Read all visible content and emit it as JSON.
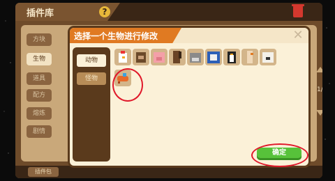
{
  "back_screen": {
    "title": "插件库",
    "help_label": "?",
    "side_tabs": [
      "方块",
      "生物",
      "道具",
      "配方",
      "熔炼",
      "剧情"
    ],
    "active_tab_index": 1,
    "bottom_button": "插件包",
    "page_indicator": "1/"
  },
  "dialog": {
    "title": "选择一个生物进行修改",
    "close_label": "✕",
    "categories": [
      {
        "label": "动物",
        "selected": true
      },
      {
        "label": "怪物",
        "selected": false
      }
    ],
    "creatures": [
      {
        "icon": "chicken-icon",
        "color": "#ffffff"
      },
      {
        "icon": "bear-icon",
        "color": "#6b4a2a"
      },
      {
        "icon": "pig-icon",
        "color": "#f4a0a8"
      },
      {
        "icon": "horse-icon",
        "color": "#6a4426"
      },
      {
        "icon": "wolf-icon",
        "color": "#8a8a8a"
      },
      {
        "icon": "sheep-icon",
        "color": "#2c5fb8"
      },
      {
        "icon": "penguin-icon",
        "color": "#222222"
      },
      {
        "icon": "ostrich-icon",
        "color": "#f0d8b8"
      },
      {
        "icon": "polar-bear-icon",
        "color": "#f4f1ea"
      },
      {
        "icon": "chameleon-icon",
        "color": "#e86a2a"
      }
    ],
    "confirm_label": "确定"
  }
}
